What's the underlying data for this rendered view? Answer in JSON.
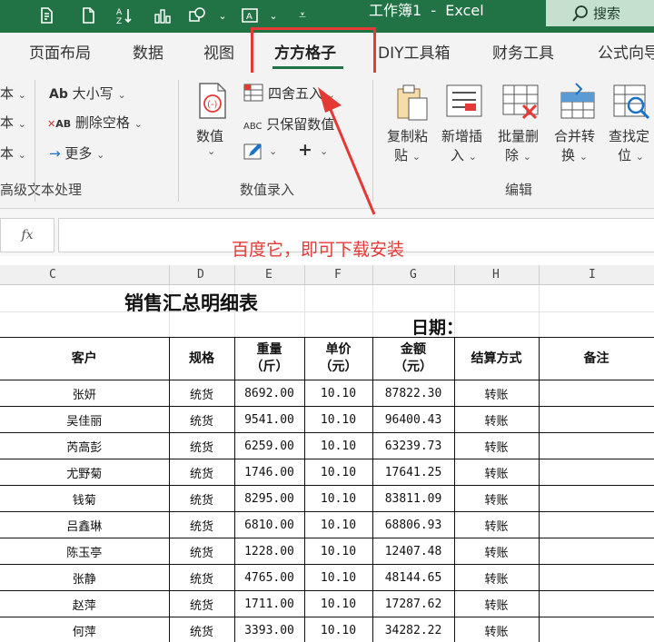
{
  "titlebar": {
    "workbook_title": "工作簿1  -  Excel",
    "search_label": "搜索",
    "qa_icons": [
      "file-icon",
      "new-doc-icon",
      "sort-az-icon",
      "chart-icon",
      "shapes-icon",
      "textbox-icon",
      "more-icon"
    ]
  },
  "tabs": [
    "页面布局",
    "数据",
    "视图",
    "方方格子",
    "DIY工具箱",
    "财务工具",
    "公式向导"
  ],
  "active_tab": "方方格子",
  "ribbon": {
    "left_group": {
      "items": [
        "本",
        "本",
        "本"
      ],
      "label": "高级文本处理"
    },
    "text_tools": {
      "case_label": "大小写",
      "case_prefix": "Ab",
      "remove_space_label": "删除空格",
      "remove_space_prefix": "AB",
      "more_label": "更多"
    },
    "numeric_group": {
      "big_button_label": "数值",
      "round_label": "四舍五入",
      "keep_value_label": "只保留数值",
      "keep_value_prefix": "ABC",
      "plus_label": "+",
      "label": "数值录入"
    },
    "edit_group": {
      "buttons": [
        {
          "line1": "复制粘",
          "line2": "贴"
        },
        {
          "line1": "新增插",
          "line2": "入"
        },
        {
          "line1": "批量删",
          "line2": "除"
        },
        {
          "line1": "合并转",
          "line2": "换"
        },
        {
          "line1": "查找定",
          "line2": "位"
        }
      ],
      "label": "编辑"
    }
  },
  "formula_bar": {
    "fx": "fx",
    "annotation": "百度它，即可下载安装"
  },
  "sheet": {
    "columns": [
      "C",
      "D",
      "E",
      "F",
      "G",
      "H",
      "I"
    ],
    "title": "销售汇总明细表",
    "date_label": "日期：",
    "headers": [
      {
        "line1": "客户",
        "line2": ""
      },
      {
        "line1": "规格",
        "line2": ""
      },
      {
        "line1": "重量",
        "line2": "（斤）"
      },
      {
        "line1": "单价",
        "line2": "（元）"
      },
      {
        "line1": "金额",
        "line2": "（元）"
      },
      {
        "line1": "结算方式",
        "line2": ""
      },
      {
        "line1": "备注",
        "line2": ""
      }
    ],
    "rows": [
      [
        "张妍",
        "统货",
        "8692.00",
        "10.10",
        "87822.30",
        "转账",
        ""
      ],
      [
        "吴佳丽",
        "统货",
        "9541.00",
        "10.10",
        "96400.43",
        "转账",
        ""
      ],
      [
        "芮高彭",
        "统货",
        "6259.00",
        "10.10",
        "63239.73",
        "转账",
        ""
      ],
      [
        "尤野菊",
        "统货",
        "1746.00",
        "10.10",
        "17641.25",
        "转账",
        ""
      ],
      [
        "钱菊",
        "统货",
        "8295.00",
        "10.10",
        "83811.09",
        "转账",
        ""
      ],
      [
        "吕鑫琳",
        "统货",
        "6810.00",
        "10.10",
        "68806.93",
        "转账",
        ""
      ],
      [
        "陈玉亭",
        "统货",
        "1228.00",
        "10.10",
        "12407.48",
        "转账",
        ""
      ],
      [
        "张静",
        "统货",
        "4765.00",
        "10.10",
        "48144.65",
        "转账",
        ""
      ],
      [
        "赵萍",
        "统货",
        "1711.00",
        "10.10",
        "17287.62",
        "转账",
        ""
      ],
      [
        "何萍",
        "统货",
        "3393.00",
        "10.10",
        "34282.22",
        "转账",
        ""
      ]
    ]
  },
  "colors": {
    "excel_green": "#217346",
    "highlight_red": "#e53935",
    "ribbon_bg": "#f3f3f3"
  }
}
